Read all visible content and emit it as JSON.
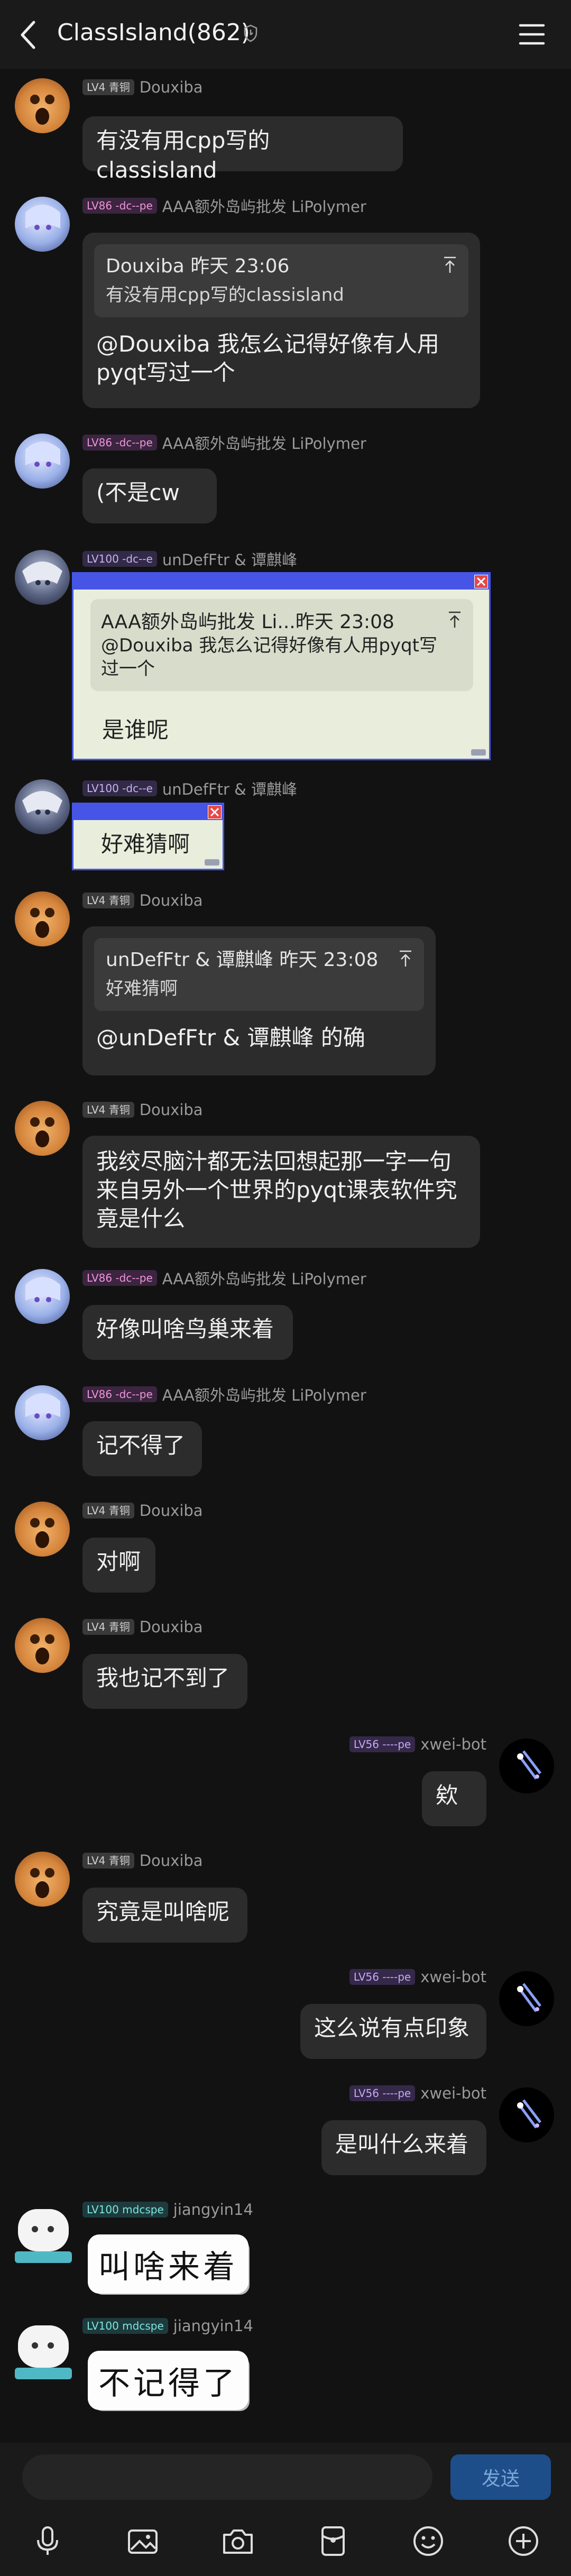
{
  "header": {
    "title": "ClassIsland(862)"
  },
  "messages": [
    {
      "badge": "LV4 青铜",
      "nick": "Douxiba",
      "text": "有没有用cpp写的classisland"
    },
    {
      "badge": "LV86 -dc--pe",
      "nick": "AAA额外岛屿批发 LiPolymer",
      "quote_head": "Douxiba 昨天 23:06",
      "quote_body": "有没有用cpp写的classisland",
      "text": "@Douxiba 我怎么记得好像有人用pyqt写过一个"
    },
    {
      "badge": "LV86 -dc--pe",
      "nick": "AAA额外岛屿批发 LiPolymer",
      "text": "(不是cw"
    },
    {
      "badge": "LV100 -dc--e",
      "nick": "unDefFtr & 谭麒峰",
      "quote_head": "AAA额外岛屿批发 Li...昨天 23:08",
      "quote_body": "@Douxiba 我怎么记得好像有人用pyqt写过一个",
      "text": "是谁呢"
    },
    {
      "badge": "LV100 -dc--e",
      "nick": "unDefFtr & 谭麒峰",
      "text": "好难猜啊"
    },
    {
      "badge": "LV4 青铜",
      "nick": "Douxiba",
      "quote_head": "unDefFtr & 谭麒峰 昨天 23:08",
      "quote_body": "好难猜啊",
      "text": "@unDefFtr & 谭麒峰 的确"
    },
    {
      "badge": "LV4 青铜",
      "nick": "Douxiba",
      "text": "我绞尽脑汁都无法回想起那一字一句来自另外一个世界的pyqt课表软件究竟是什么"
    },
    {
      "badge": "LV86 -dc--pe",
      "nick": "AAA额外岛屿批发 LiPolymer",
      "text": "好像叫啥鸟巢来着"
    },
    {
      "badge": "LV86 -dc--pe",
      "nick": "AAA额外岛屿批发 LiPolymer",
      "text": "记不得了"
    },
    {
      "badge": "LV4 青铜",
      "nick": "Douxiba",
      "text": "对啊"
    },
    {
      "badge": "LV4 青铜",
      "nick": "Douxiba",
      "text": "我也记不到了"
    },
    {
      "badge": "LV56 ----pe",
      "nick": "xwei-bot",
      "text": "欸"
    },
    {
      "badge": "LV4 青铜",
      "nick": "Douxiba",
      "text": "究竟是叫啥呢"
    },
    {
      "badge": "LV56 ----pe",
      "nick": "xwei-bot",
      "text": "这么说有点印象"
    },
    {
      "badge": "LV56 ----pe",
      "nick": "xwei-bot",
      "text": "是叫什么来着"
    },
    {
      "badge": "LV100 mdcspe",
      "nick": "jiangyin14",
      "text": "叫啥来着"
    },
    {
      "badge": "LV100 mdcspe",
      "nick": "jiangyin14",
      "text": "不记得了"
    }
  ],
  "input": {
    "send_label": "发送"
  },
  "colors": {
    "background": "#121212",
    "bubble": "#2c2c2c",
    "accent": "#1e4e8a",
    "window_frame": "#4655e6"
  }
}
